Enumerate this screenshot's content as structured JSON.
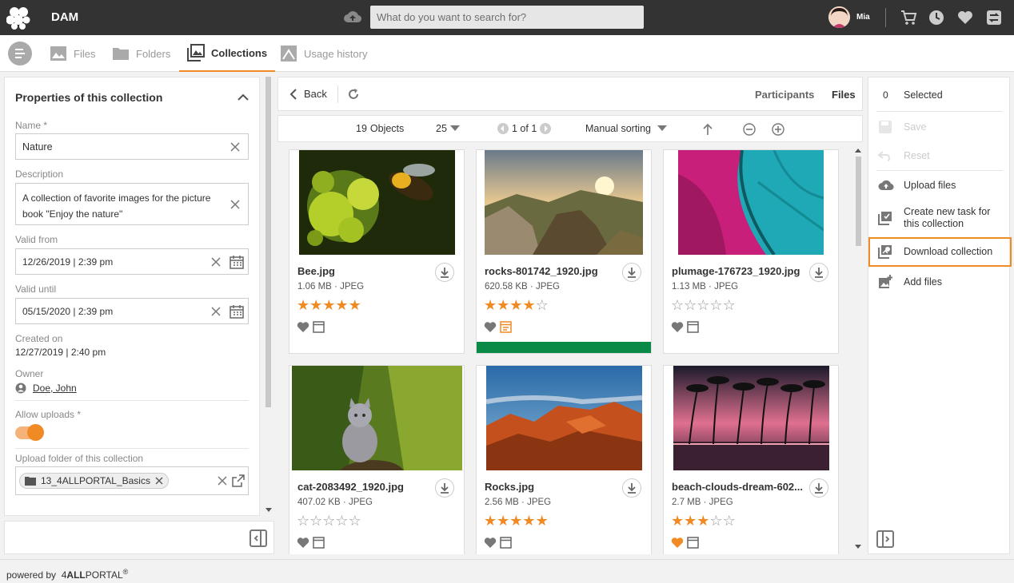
{
  "app": {
    "title": "DAM",
    "user": "Mia"
  },
  "search": {
    "placeholder": "What do you want to search for?"
  },
  "tabs": [
    {
      "label": "Files",
      "icon": "image-icon",
      "active": false
    },
    {
      "label": "Folders",
      "icon": "folder-icon",
      "active": false
    },
    {
      "label": "Collections",
      "icon": "collections-icon",
      "active": true
    },
    {
      "label": "Usage history",
      "icon": "usage-history-icon",
      "active": false
    }
  ],
  "properties": {
    "title": "Properties of this collection",
    "name_label": "Name *",
    "name_value": "Nature",
    "description_label": "Description",
    "description_value": "A collection of favorite images for the picture book \"Enjoy the nature\"",
    "valid_from_label": "Valid from",
    "valid_from_value": "12/26/2019 | 2:39 pm",
    "valid_until_label": "Valid until",
    "valid_until_value": "05/15/2020 | 2:39 pm",
    "created_on_label": "Created on",
    "created_on_value": "12/27/2019 | 2:40 pm",
    "owner_label": "Owner",
    "owner_value": "Doe, John",
    "allow_uploads_label": "Allow uploads *",
    "allow_uploads_on": true,
    "upload_folder_label": "Upload folder of this collection",
    "upload_folder_value": "13_4ALLPORTAL_Basics"
  },
  "center": {
    "back_label": "Back",
    "participants_label": "Participants",
    "files_label": "Files",
    "object_count": "19",
    "objects_label": "Objects",
    "page_size": "25",
    "page_info": "1 of 1",
    "sorting": "Manual sorting"
  },
  "files": [
    {
      "name": "Bee.jpg",
      "size": "1.06 MB",
      "type": "JPEG",
      "rating": 5,
      "accent": "#c7d83a"
    },
    {
      "name": "rocks-801742_1920.jpg",
      "size": "620.58 KB",
      "type": "JPEG",
      "rating": 4,
      "accent": "#8a6a3a"
    },
    {
      "name": "plumage-176723_1920.jpg",
      "size": "1.13 MB",
      "type": "JPEG",
      "rating": 0,
      "accent": "#c81f7a"
    },
    {
      "name": "cat-2083492_1920.jpg",
      "size": "407.02 KB",
      "type": "JPEG",
      "rating": 0,
      "accent": "#6f8f2a"
    },
    {
      "name": "Rocks.jpg",
      "size": "2.56 MB",
      "type": "JPEG",
      "rating": 5,
      "accent": "#c4501e"
    },
    {
      "name": "beach-clouds-dream-602...",
      "size": "2.7 MB",
      "type": "JPEG",
      "rating": 3,
      "accent": "#c8506a"
    }
  ],
  "right": {
    "selected_count": "0",
    "selected_label": "Selected",
    "save_label": "Save",
    "reset_label": "Reset",
    "upload_files_label": "Upload files",
    "create_task_label": "Create new task for this collection",
    "download_collection_label": "Download collection",
    "add_files_label": "Add files"
  },
  "footer": {
    "powered_by": "powered by",
    "brand_light": "4",
    "brand_bold": "ALL",
    "brand_rest": "PORTAL",
    "reg": "®"
  },
  "colors": {
    "accent": "#f08a24",
    "topbar": "#333333",
    "green_bar": "#0a8a47"
  }
}
